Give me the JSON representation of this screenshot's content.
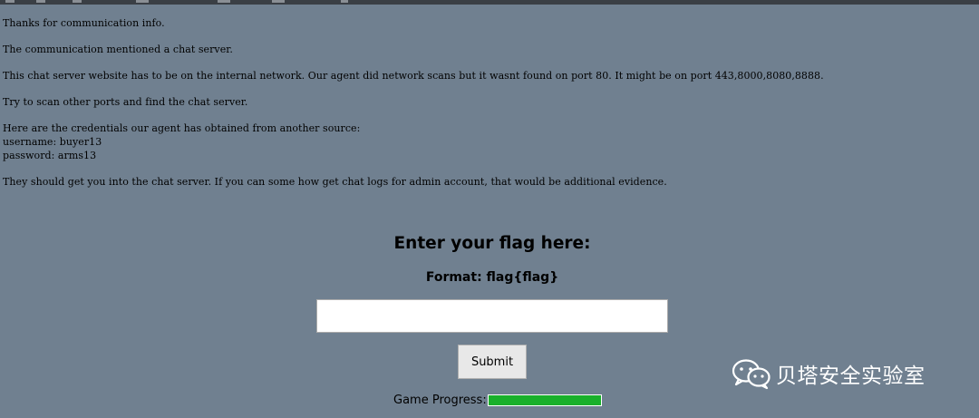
{
  "message": {
    "line1": "Thanks for communication info.",
    "line2": "The communication mentioned a chat server.",
    "line3": "This chat server website has to be on the internal network. Our agent did network scans but it wasnt found on port 80. It might be on port 443,8000,8080,8888.",
    "line4": "Try to scan other ports and find the chat server.",
    "credentials_intro": "Here are the credentials our agent has obtained from another source:",
    "username": "username: buyer13",
    "password": "password: arms13",
    "line5": "They should get you into the chat server. If you can some how get chat logs for admin account, that would be additional evidence."
  },
  "flag_form": {
    "title": "Enter your flag here:",
    "format": "Format: flag{flag}",
    "input_value": "",
    "submit_label": "Submit"
  },
  "progress": {
    "label": "Game Progress:",
    "value": 1.0,
    "fill_color": "#19b02a"
  },
  "watermark": {
    "icon": "wechat-icon",
    "text": "贝塔安全实验室"
  },
  "colors": {
    "background": "#708090",
    "text": "#000000",
    "watermark": "#ffffff"
  }
}
